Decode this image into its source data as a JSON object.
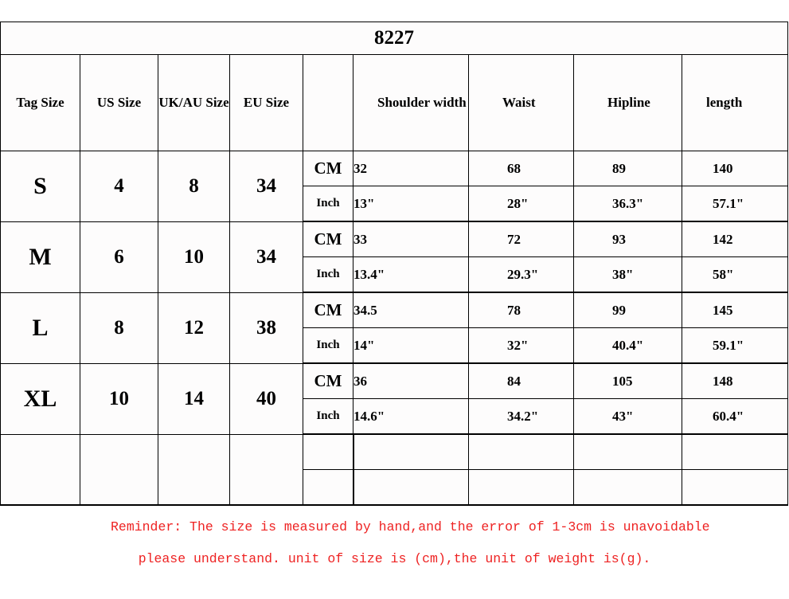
{
  "title": "8227",
  "accent_color": "#ee2222",
  "headers": {
    "tag_size": "Tag Size",
    "us_size": "US Size",
    "uk_au_size": "UK/AU Size",
    "eu_size": "EU Size",
    "unit": "",
    "shoulder_width": "Shoulder width",
    "waist": "Waist",
    "hipline": "Hipline",
    "length": "length"
  },
  "unit_labels": {
    "cm": "CM",
    "inch": "Inch"
  },
  "rows": [
    {
      "tag_size": "S",
      "us_size": "4",
      "uk_au_size": "8",
      "eu_size": "34",
      "cm": {
        "shoulder_width": "32",
        "waist": "68",
        "hipline": "89",
        "length": "140"
      },
      "inch": {
        "shoulder_width": "13\"",
        "waist": "28\"",
        "hipline": "36.3\"",
        "length": "57.1\""
      }
    },
    {
      "tag_size": "M",
      "us_size": "6",
      "uk_au_size": "10",
      "eu_size": "34",
      "cm": {
        "shoulder_width": "33",
        "waist": "72",
        "hipline": "93",
        "length": "142"
      },
      "inch": {
        "shoulder_width": "13.4\"",
        "waist": "29.3\"",
        "hipline": "38\"",
        "length": "58\""
      }
    },
    {
      "tag_size": "L",
      "us_size": "8",
      "uk_au_size": "12",
      "eu_size": "38",
      "cm": {
        "shoulder_width": "34.5",
        "waist": "78",
        "hipline": "99",
        "length": "145"
      },
      "inch": {
        "shoulder_width": "14\"",
        "waist": "32\"",
        "hipline": "40.4\"",
        "length": "59.1\""
      }
    },
    {
      "tag_size": "XL",
      "us_size": "10",
      "uk_au_size": "14",
      "eu_size": "40",
      "cm": {
        "shoulder_width": "36",
        "waist": "84",
        "hipline": "105",
        "length": "148"
      },
      "inch": {
        "shoulder_width": "14.6\"",
        "waist": "34.2\"",
        "hipline": "43\"",
        "length": "60.4\""
      }
    }
  ],
  "empty_rows": [
    {
      "tag_size": "",
      "us_size": "",
      "uk_au_size": "",
      "eu_size": "",
      "cm": {
        "shoulder_width": "",
        "waist": "",
        "hipline": "",
        "length": ""
      },
      "inch": {
        "shoulder_width": "",
        "waist": "",
        "hipline": "",
        "length": ""
      }
    }
  ],
  "reminder": {
    "line1": "Reminder: The size is measured by hand,and the error of 1-3cm is unavoidable",
    "line2": "please understand. unit of size is (cm),the unit of weight is(g)."
  }
}
